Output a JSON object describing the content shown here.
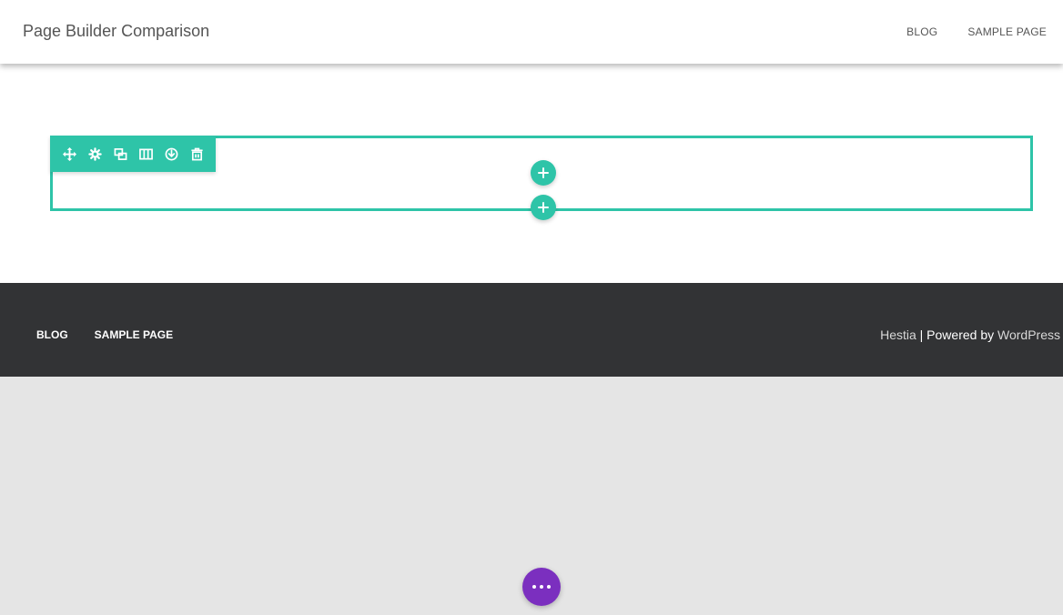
{
  "header": {
    "site_title": "Page Builder Comparison",
    "nav": [
      {
        "label": "BLOG"
      },
      {
        "label": "SAMPLE PAGE"
      }
    ]
  },
  "builder": {
    "accent_color": "#2ec4a8",
    "toolbar_icons": [
      "move-icon",
      "settings-icon",
      "duplicate-icon",
      "columns-icon",
      "save-icon",
      "delete-icon"
    ],
    "add_row_icon": "plus-icon",
    "add_section_icon": "plus-icon"
  },
  "footer": {
    "nav": [
      {
        "label": "BLOG"
      },
      {
        "label": "SAMPLE PAGE"
      }
    ],
    "copyright": {
      "theme": "Hestia",
      "separator": " | Powered by ",
      "platform": "WordPress"
    },
    "background": "#323335"
  },
  "fab": {
    "icon": "more-dots-icon",
    "color": "#7b2fbf"
  }
}
